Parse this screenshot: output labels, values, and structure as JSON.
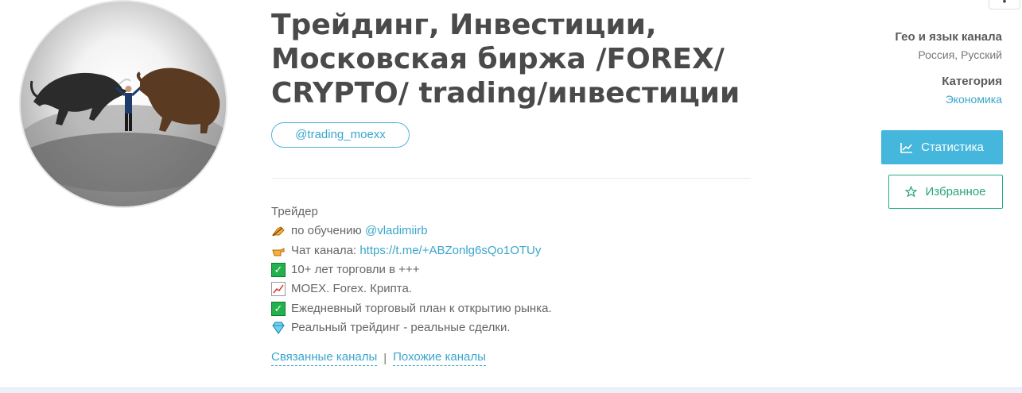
{
  "channel": {
    "title": "Трейдинг, Инвестиции, Московская биржа /FOREX/ CRYPTO/ trading/инвестиции",
    "username": "@trading_moexx"
  },
  "description": {
    "line1": "Трейдер",
    "line2_text": "по обучению ",
    "line2_link": "@vladimiirb",
    "line3_text": "Чат канала: ",
    "line3_link": "https://t.me/+ABZonlg6sQo1OTUy",
    "line4": "10+ лет торговли в +++",
    "line5": "MOEX. Forex. Крипта.",
    "line6": "Ежедневный торговый план к открытию рынка.",
    "line7": "Реальный трейдинг - реальные сделки.",
    "icons": [
      "writing-hand-icon",
      "pointing-hand-icon",
      "check-mark-icon",
      "chart-icon",
      "check-mark-icon",
      "gem-icon"
    ]
  },
  "related": {
    "related_label": "Связанные каналы",
    "separator": "|",
    "similar_label": "Похожие каналы"
  },
  "meta": {
    "geo_label": "Гео и язык канала",
    "geo_value": "Россия, Русский",
    "category_label": "Категория",
    "category_value": "Экономика"
  },
  "buttons": {
    "stats_label": "Статистика",
    "favorite_label": "Избранное"
  },
  "colors": {
    "accent": "#45b7dd",
    "link": "#3aa6cc",
    "favorite": "#21b07a",
    "title": "#4a4a4a"
  }
}
